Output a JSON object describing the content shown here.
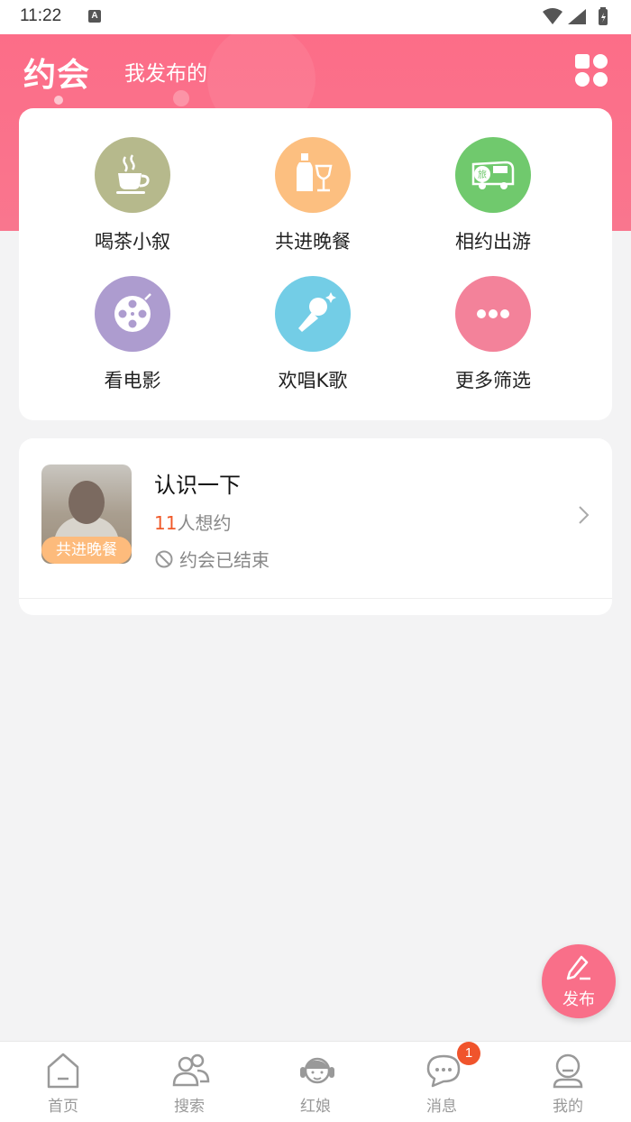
{
  "status_bar": {
    "time": "11:22",
    "notification_letter": "A"
  },
  "header": {
    "title": "约会",
    "subtitle": "我发布的",
    "menu_icon": "grid-icon"
  },
  "categories": [
    {
      "label": "喝茶小叙",
      "icon": "tea-cup-icon",
      "color": "#b6b98c"
    },
    {
      "label": "共进晚餐",
      "icon": "wine-bottle-glass-icon",
      "color": "#fcbf80"
    },
    {
      "label": "相约出游",
      "icon": "tour-bus-icon",
      "color": "#70c96d"
    },
    {
      "label": "看电影",
      "icon": "film-reel-icon",
      "color": "#ad9ccf"
    },
    {
      "label": "欢唱K歌",
      "icon": "microphone-icon",
      "color": "#73cde6"
    },
    {
      "label": "更多筛选",
      "icon": "more-dots-icon",
      "color": "#f3829a"
    }
  ],
  "date_item": {
    "title": "认识一下",
    "category_badge": "共进晚餐",
    "interested_count": "11",
    "interested_suffix": "人想约",
    "status": "约会已结束"
  },
  "fab": {
    "label": "发布",
    "icon": "edit-pencil-icon",
    "color": "#f96f89"
  },
  "bottom_nav": [
    {
      "label": "首页",
      "icon": "home-icon"
    },
    {
      "label": "搜索",
      "icon": "people-search-icon"
    },
    {
      "label": "红娘",
      "icon": "matchmaker-headset-icon"
    },
    {
      "label": "消息",
      "icon": "chat-bubble-icon",
      "badge": "1"
    },
    {
      "label": "我的",
      "icon": "profile-icon"
    }
  ],
  "colors": {
    "brand": "#fc6d88",
    "accent_number": "#f05a2a",
    "badge": "#f0542c"
  }
}
